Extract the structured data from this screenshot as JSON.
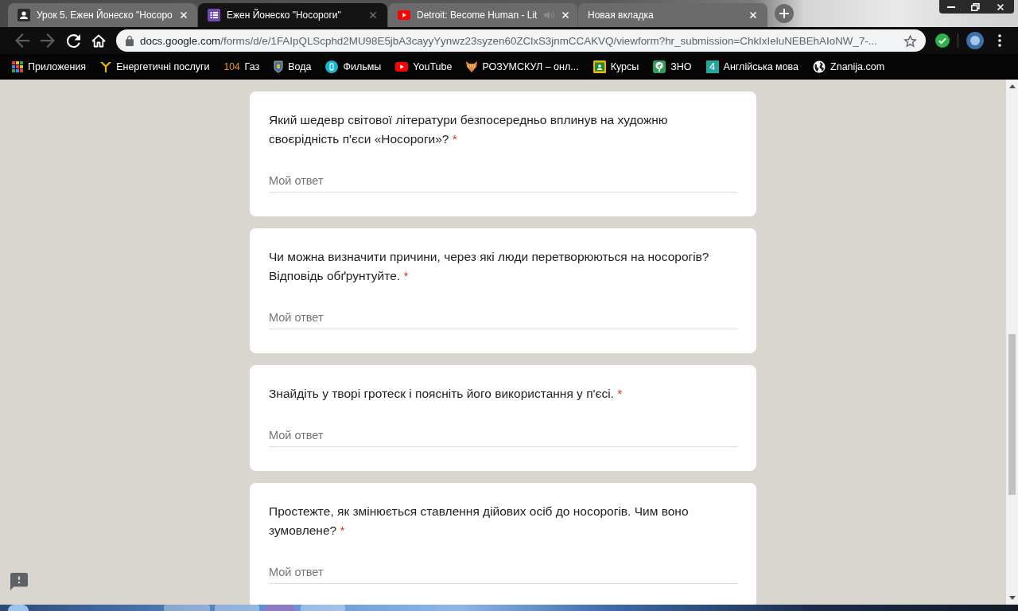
{
  "browser": {
    "tabs": [
      {
        "title": "Урок 5. Ежен Йонеско \"Носоро",
        "kind": "person",
        "selected": false,
        "audio": false
      },
      {
        "title": "Ежен Йонеско \"Носороги\"",
        "kind": "form",
        "selected": true,
        "audio": false
      },
      {
        "title": "Detroit: Become Human - Lit",
        "kind": "play",
        "selected": false,
        "audio": true
      },
      {
        "title": "Новая вкладка",
        "kind": "blank",
        "selected": false,
        "audio": false
      }
    ],
    "toolbar": {
      "back_disabled": true,
      "forward_disabled": true,
      "url": {
        "host": "docs.google.com",
        "path": "/forms/d/e/1FAIpQLScphd2MU98E5jbA3cayyYynwz23syzen60ZClxS3jnmCCAKVQ/viewform?hr_submission=ChkIxIeluNEBEhAIoNW_7-..."
      }
    },
    "bookmarks": [
      {
        "label": "Приложения",
        "kind": "grid"
      },
      {
        "label": "Енергетичні послуги",
        "kind": "ylogo"
      },
      {
        "label": "Газ",
        "kind": "number",
        "logo": "104"
      },
      {
        "label": "Вода",
        "kind": "shield"
      },
      {
        "label": "Фильмы",
        "kind": "phone"
      },
      {
        "label": "YouTube",
        "kind": "play"
      },
      {
        "label": "РОЗУМСКУЛ – онл...",
        "kind": "fox"
      },
      {
        "label": "Курсы",
        "kind": "board"
      },
      {
        "label": "ЗНО",
        "kind": "tree"
      },
      {
        "label": "Англійська мова",
        "kind": "tile",
        "logo": "4"
      },
      {
        "label": "Znanija.com",
        "kind": "globe"
      }
    ]
  },
  "form": {
    "questions": [
      {
        "text": "Який шедевр світової літератури безпосередньо вплинув на художню своєрідність п'єси «Носороги»?",
        "required_mark": "*",
        "answer": {
          "placeholder": "Мой ответ"
        }
      },
      {
        "text": "Чи можна визначити причини, через які люди перетворюються на носорогів? Відповідь обґрунтуйте.",
        "required_mark": "*",
        "answer": {
          "placeholder": "Мой ответ"
        }
      },
      {
        "text": "Знайдіть у творі гротеск і поясніть його використання у п'єсі.",
        "required_mark": "*",
        "answer": {
          "placeholder": "Мой ответ"
        }
      },
      {
        "text": "Простежте, як змінюється ставлення дійових осіб до носорогів. Чим воно зумовлене?",
        "required_mark": "*",
        "answer": {
          "placeholder": "Мой ответ"
        }
      }
    ]
  }
}
